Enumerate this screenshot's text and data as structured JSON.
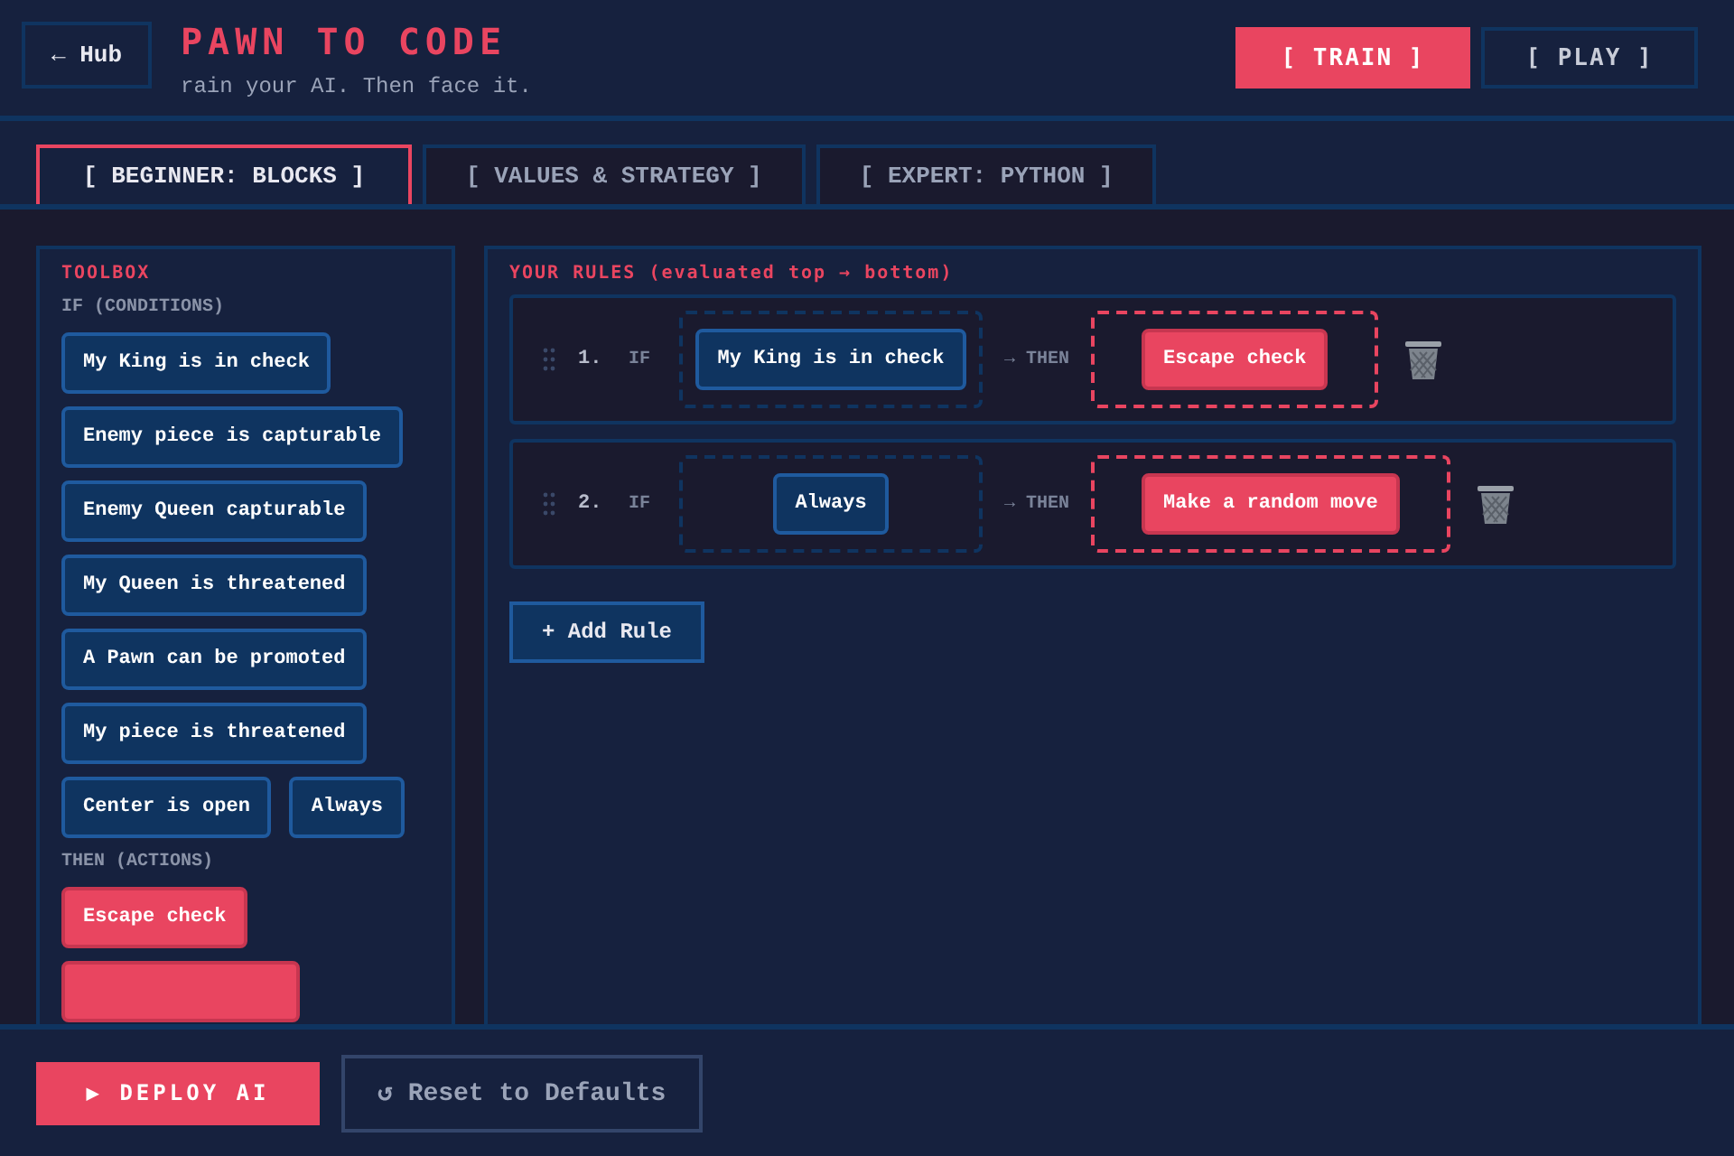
{
  "header": {
    "back_button": "← Hub",
    "title": "PAWN TO CODE",
    "subtitle": "rain your AI. Then face it.",
    "modes": [
      {
        "label": "[ TRAIN ]",
        "selected": true
      },
      {
        "label": "[ PLAY ]",
        "selected": false
      }
    ]
  },
  "tabs": [
    {
      "label": "[ BEGINNER: BLOCKS ]",
      "selected": true
    },
    {
      "label": "[ VALUES & STRATEGY ]",
      "selected": false
    },
    {
      "label": "[ EXPERT: PYTHON ]",
      "selected": false
    }
  ],
  "toolbox": {
    "title": "TOOLBOX",
    "sections": [
      {
        "heading": "IF (CONDITIONS)",
        "blocks": [
          {
            "kind": "condition",
            "label": "My King is in check"
          },
          {
            "kind": "condition",
            "label": "Enemy piece is capturable"
          },
          {
            "kind": "condition",
            "label": "Enemy Queen capturable"
          },
          {
            "kind": "condition",
            "label": "My Queen is threatened"
          },
          {
            "kind": "condition",
            "label": "A Pawn can be promoted"
          },
          {
            "kind": "condition",
            "label": "My piece is threatened"
          },
          {
            "kind": "condition",
            "label": "Center is open"
          },
          {
            "kind": "condition",
            "label": "Always"
          }
        ]
      },
      {
        "heading": "THEN (ACTIONS)",
        "blocks": [
          {
            "kind": "action",
            "label": "Escape check"
          },
          {
            "kind": "action-hidden"
          }
        ]
      }
    ]
  },
  "rules": {
    "title": "YOUR RULES (evaluated top → bottom)",
    "items": [
      {
        "number": "1.",
        "if_label": "IF",
        "condition": "My King is in check",
        "then_label": "→ THEN",
        "action": "Escape check"
      },
      {
        "number": "2.",
        "if_label": "IF",
        "condition": "Always",
        "then_label": "→ THEN",
        "action": "Make a random move"
      }
    ],
    "add_button": "+ Add Rule"
  },
  "footer": {
    "deploy_button": "▶ DEPLOY AI",
    "reset_button": "↺ Reset to Defaults"
  }
}
